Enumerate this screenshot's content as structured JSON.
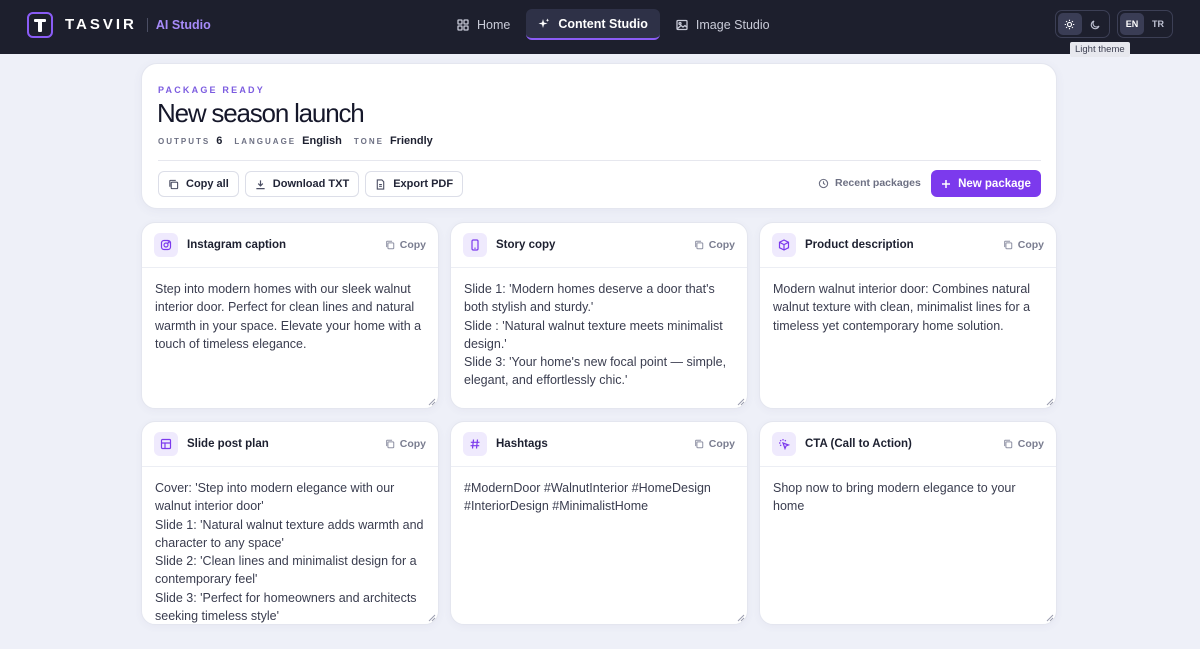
{
  "brand": {
    "name": "TASVIR",
    "sub": "AI Studio"
  },
  "nav": {
    "items": [
      {
        "label": "Home",
        "icon": "grid-icon",
        "active": false
      },
      {
        "label": "Content Studio",
        "icon": "sparkle-icon",
        "active": true
      },
      {
        "label": "Image Studio",
        "icon": "image-icon",
        "active": false
      }
    ]
  },
  "theme": {
    "light_icon": "sun-icon",
    "dark_icon": "moon-icon",
    "tooltip": "Light theme"
  },
  "lang": {
    "options": [
      "EN",
      "TR"
    ],
    "selected": "EN"
  },
  "package": {
    "eyebrow": "PACKAGE READY",
    "title": "New season launch",
    "meta": [
      {
        "label": "OUTPUTS",
        "value": "6"
      },
      {
        "label": "LANGUAGE",
        "value": "English"
      },
      {
        "label": "TONE",
        "value": "Friendly"
      }
    ],
    "actions": {
      "copy_all": "Copy all",
      "download": "Download TXT",
      "export": "Export PDF",
      "recent": "Recent packages",
      "new": "New package"
    }
  },
  "outputs": [
    {
      "title": "Instagram caption",
      "icon": "instagram-icon",
      "copy": "Copy",
      "body": "Step into modern homes with our sleek walnut interior door. Perfect for clean lines and natural warmth in your space. Elevate your home with a touch of timeless elegance."
    },
    {
      "title": "Story copy",
      "icon": "phone-icon",
      "copy": "Copy",
      "body": "Slide 1: 'Modern homes deserve a door that's both stylish and sturdy.'\nSlide : 'Natural walnut texture meets minimalist design.'\nSlide 3: 'Your home's new focal point — simple, elegant, and effortlessly chic.'"
    },
    {
      "title": "Product description",
      "icon": "box-icon",
      "copy": "Copy",
      "body": "Modern walnut interior door: Combines natural walnut texture with clean, minimalist lines for a timeless yet contemporary home solution."
    },
    {
      "title": "Slide post plan",
      "icon": "layout-icon",
      "copy": "Copy",
      "body": "Cover: 'Step into modern elegance with our walnut interior door'\nSlide 1: 'Natural walnut texture adds warmth and character to any space'\nSlide 2: 'Clean lines and minimalist design for a contemporary feel'\nSlide 3: 'Perfect for homeowners and architects seeking timeless style'"
    },
    {
      "title": "Hashtags",
      "icon": "hash-icon",
      "copy": "Copy",
      "body": "#ModernDoor #WalnutInterior #HomeDesign #InteriorDesign #MinimalistHome"
    },
    {
      "title": "CTA (Call to Action)",
      "icon": "click-icon",
      "copy": "Copy",
      "body": "Shop now to bring modern elegance to your home"
    }
  ],
  "colors": {
    "accent": "#7c3aed",
    "topbar": "#1d1f2d",
    "background": "#eef0f8"
  }
}
